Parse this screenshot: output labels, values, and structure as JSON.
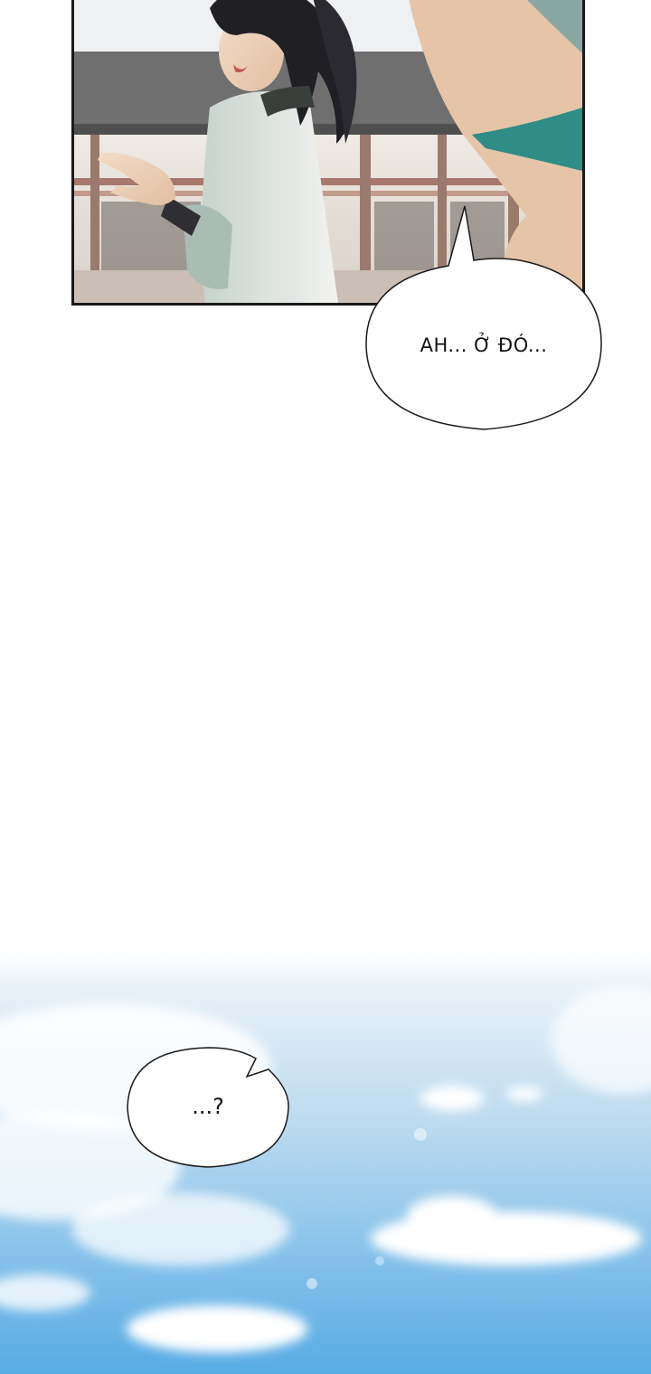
{
  "panel_1": {
    "description_icon": "character-pointing-illustration"
  },
  "bubbles": {
    "speech_1": {
      "text": "AH... Ở ĐÓ..."
    },
    "speech_2": {
      "text": "...?"
    }
  },
  "colors": {
    "ink": "#111111",
    "sky_top": "#e3eef7",
    "sky_bottom": "#5aaee6",
    "panel_border": "#1a1a1a"
  }
}
